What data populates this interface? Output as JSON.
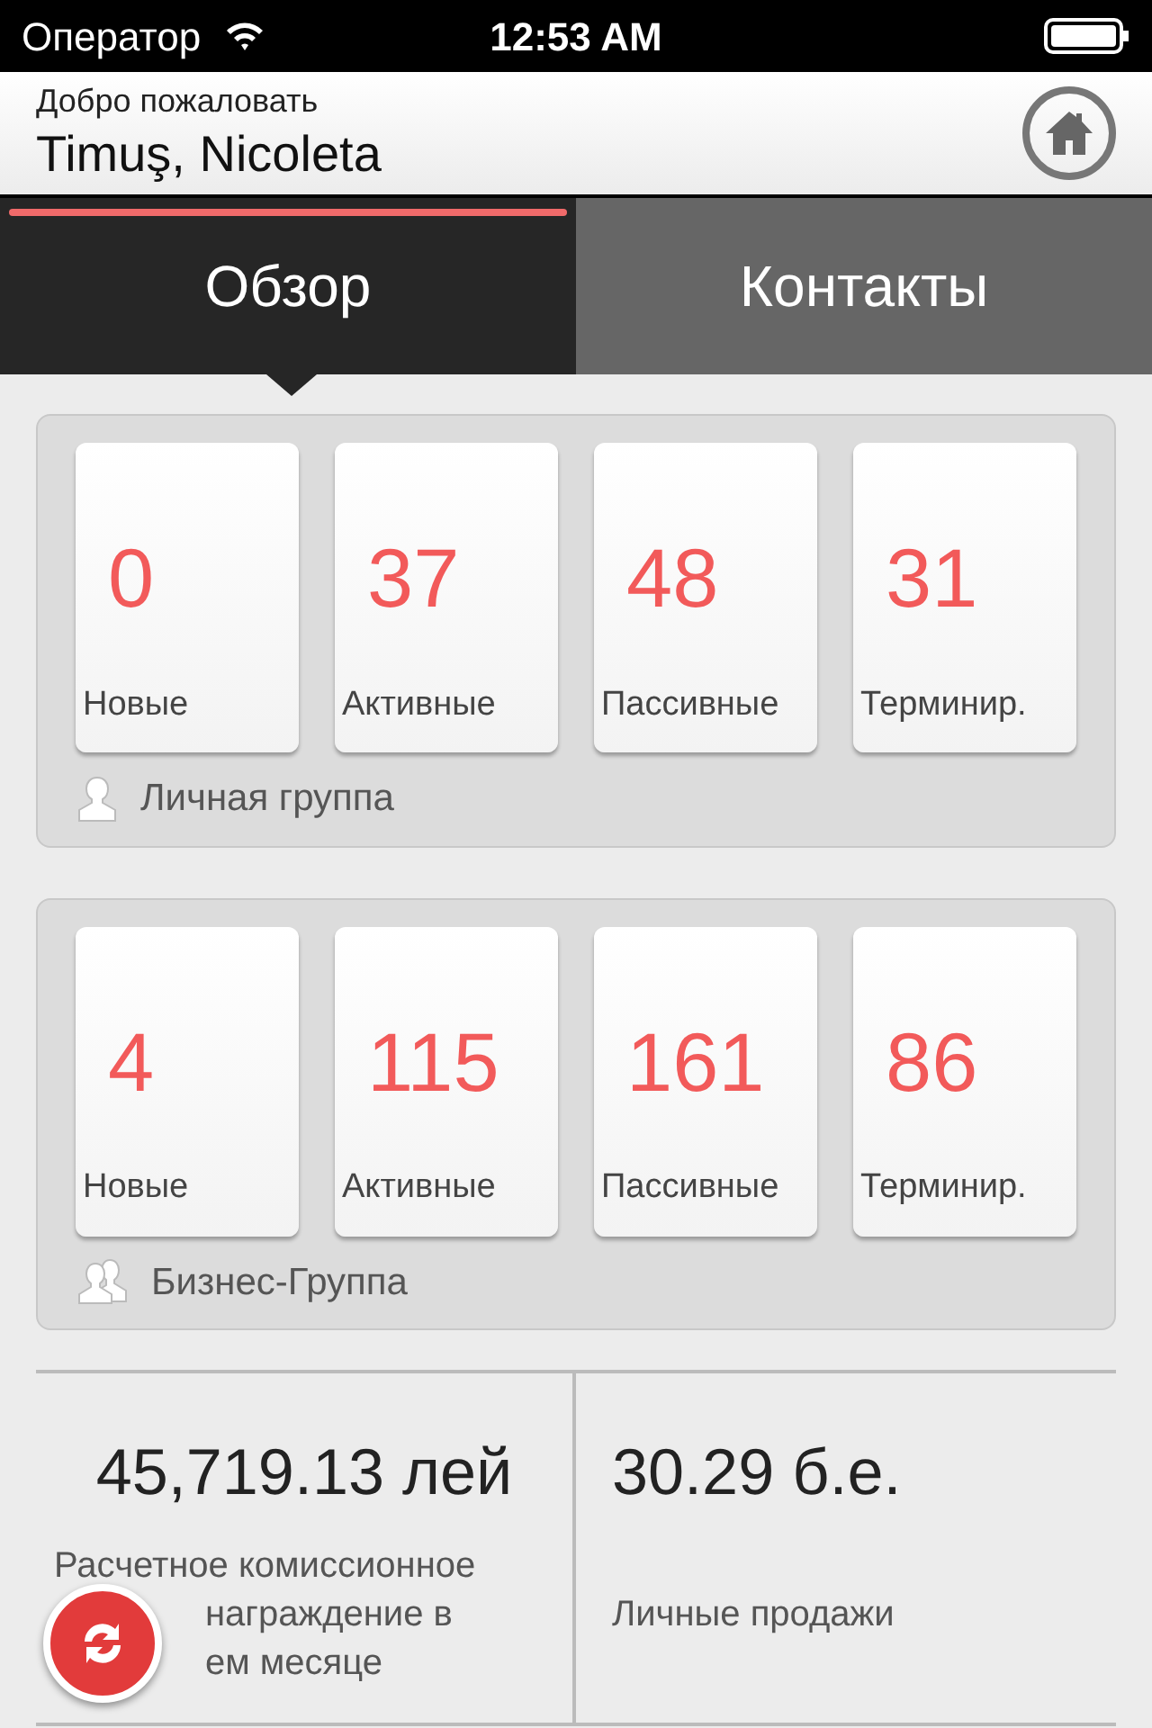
{
  "status_bar": {
    "carrier": "Оператор",
    "time": "12:53 AM"
  },
  "header": {
    "greeting": "Добро пожаловать",
    "user_name": "Timuş, Nicoleta"
  },
  "tabs": [
    {
      "label": "Обзор",
      "selected": true
    },
    {
      "label": "Контакты",
      "selected": false
    }
  ],
  "groups": [
    {
      "name": "Личная группа",
      "kind": "personal",
      "tiles": [
        {
          "value": "0",
          "label": "Новые"
        },
        {
          "value": "37",
          "label": "Активные"
        },
        {
          "value": "48",
          "label": "Пассивные"
        },
        {
          "value": "31",
          "label": "Терминир."
        }
      ]
    },
    {
      "name": "Бизнес-Группа",
      "kind": "business",
      "tiles": [
        {
          "value": "4",
          "label": "Новые"
        },
        {
          "value": "115",
          "label": "Активные"
        },
        {
          "value": "161",
          "label": "Пассивные"
        },
        {
          "value": "86",
          "label": "Терминир."
        }
      ]
    }
  ],
  "stats": [
    {
      "value": "45,719.13 лей",
      "label_lines": [
        "Расчетное комиссионное",
        "награждение в",
        "ем месяце"
      ]
    },
    {
      "value": "30.29 б.е.",
      "label_lines": [
        "Личные продажи"
      ]
    }
  ]
}
